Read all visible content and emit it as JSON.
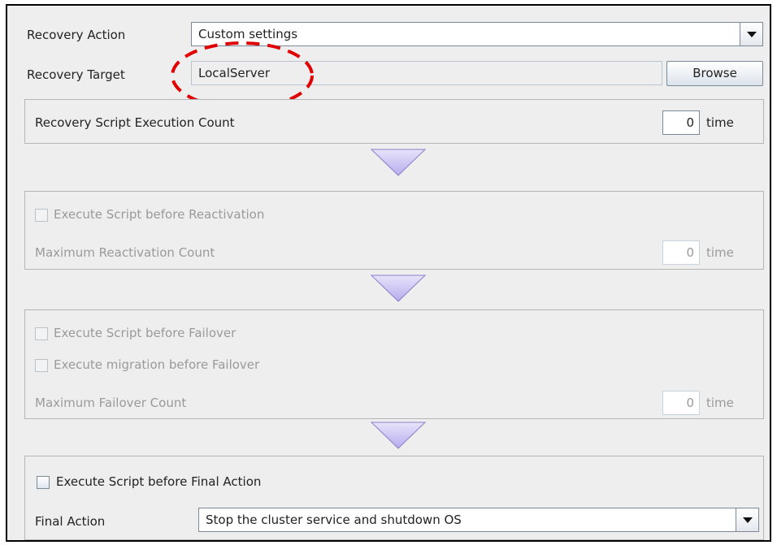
{
  "recovery_action": {
    "label": "Recovery Action",
    "value": "Custom settings"
  },
  "recovery_target": {
    "label": "Recovery Target",
    "value": "LocalServer",
    "browse_label": "Browse"
  },
  "script_execution": {
    "label": "Recovery Script Execution Count",
    "count": "0",
    "unit": "time"
  },
  "reactivation": {
    "checkbox_label": "Execute Script before Reactivation",
    "max_label": "Maximum Reactivation Count",
    "count": "0",
    "unit": "time"
  },
  "failover": {
    "script_checkbox_label": "Execute Script before Failover",
    "migration_checkbox_label": "Execute migration before Failover",
    "max_label": "Maximum Failover Count",
    "count": "0",
    "unit": "time"
  },
  "final": {
    "checkbox_label": "Execute Script before Final Action",
    "action_label": "Final Action",
    "action_value": "Stop the cluster service and shutdown OS"
  },
  "colors": {
    "highlight_ellipse": "#e10000",
    "flow_arrow": "#c8c0f0"
  }
}
